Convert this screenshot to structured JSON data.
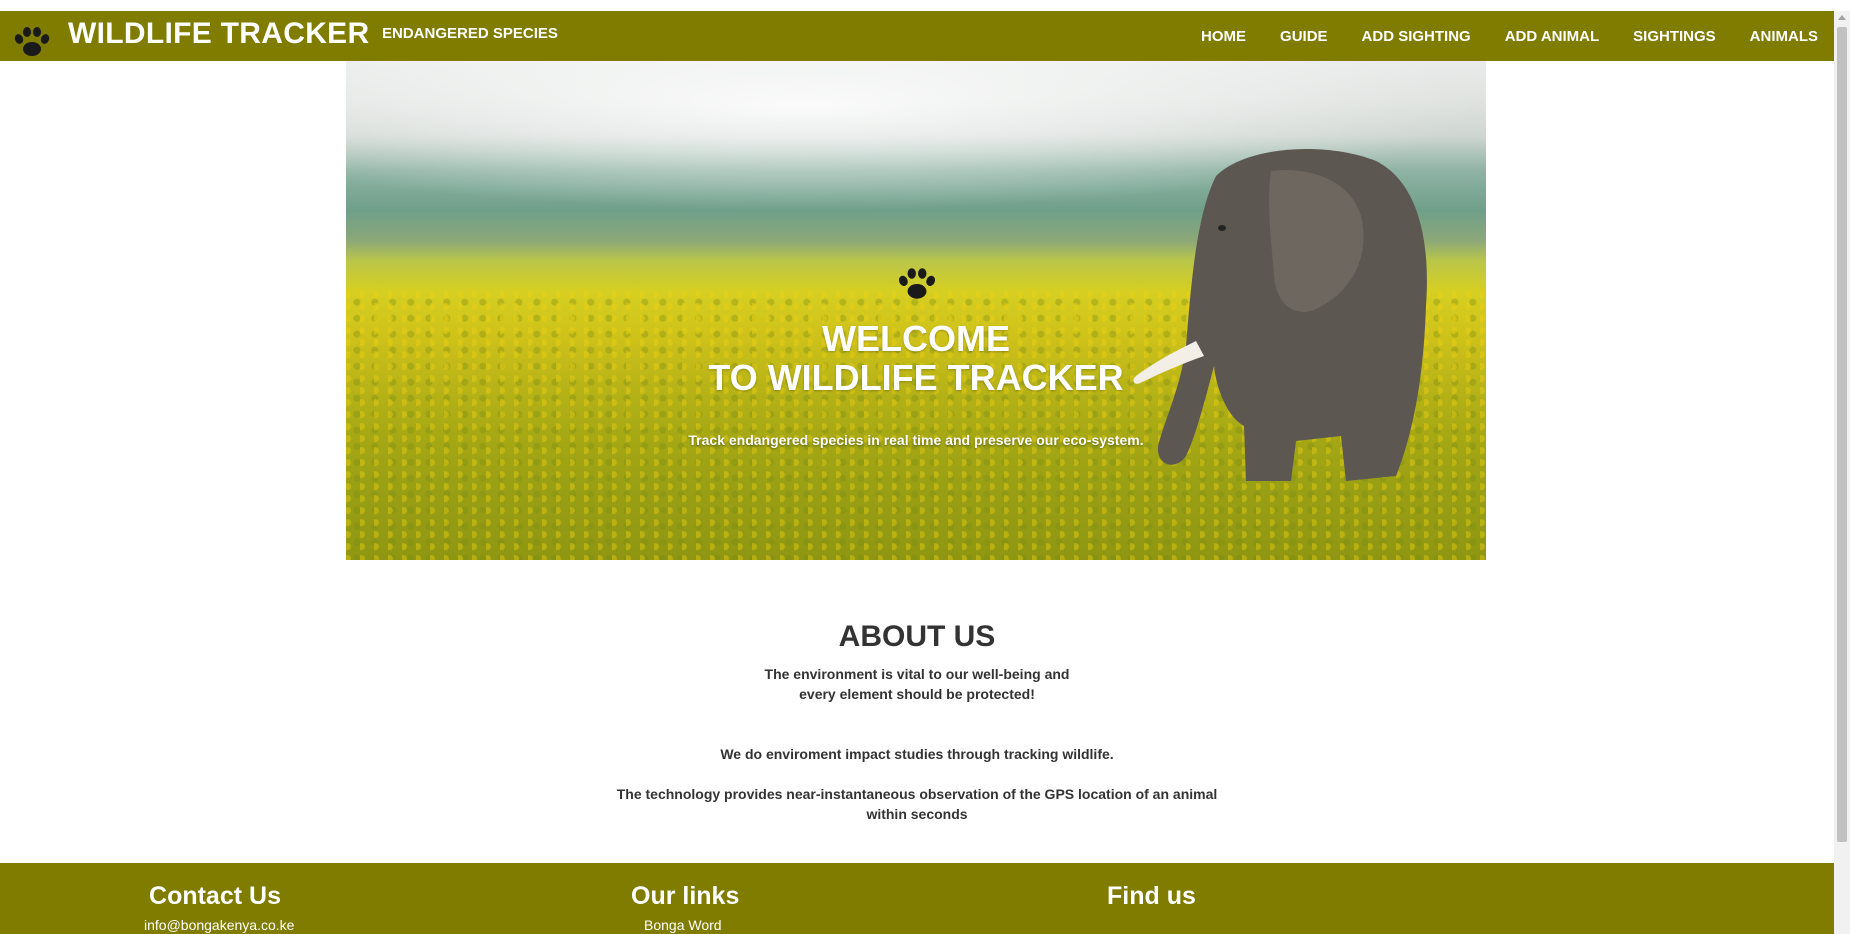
{
  "navbar": {
    "brand_title": "WILDLIFE TRACKER",
    "brand_subtitle": "ENDANGERED SPECIES",
    "brand_icon": "paw-icon",
    "links": [
      "HOME",
      "GUIDE",
      "ADD SIGHTING",
      "ADD ANIMAL",
      "SIGHTINGS",
      "ANIMALS"
    ],
    "bg_color": "#7f7c00"
  },
  "hero": {
    "icon": "paw-icon",
    "title_line1": "WELCOME",
    "title_line2": "TO WILDLIFE TRACKER",
    "tagline": "Track endangered species in real time and preserve our eco-system.",
    "image": "elephant-in-yellow-flower-field"
  },
  "about": {
    "heading": "ABOUT US",
    "paragraph1": "The environment is vital to our well-being and every element should be protected!",
    "paragraph2": "We do enviroment impact studies through tracking wildlife.",
    "paragraph3": "The technology provides near-instantaneous observation of the GPS location of an animal within seconds"
  },
  "footer": {
    "contact": {
      "heading": "Contact Us",
      "email": "info@bongakenya.co.ke"
    },
    "links": {
      "heading": "Our links",
      "first_link": "Bonga Word"
    },
    "find": {
      "heading": "Find us"
    },
    "bg_color": "#7f7c00"
  }
}
